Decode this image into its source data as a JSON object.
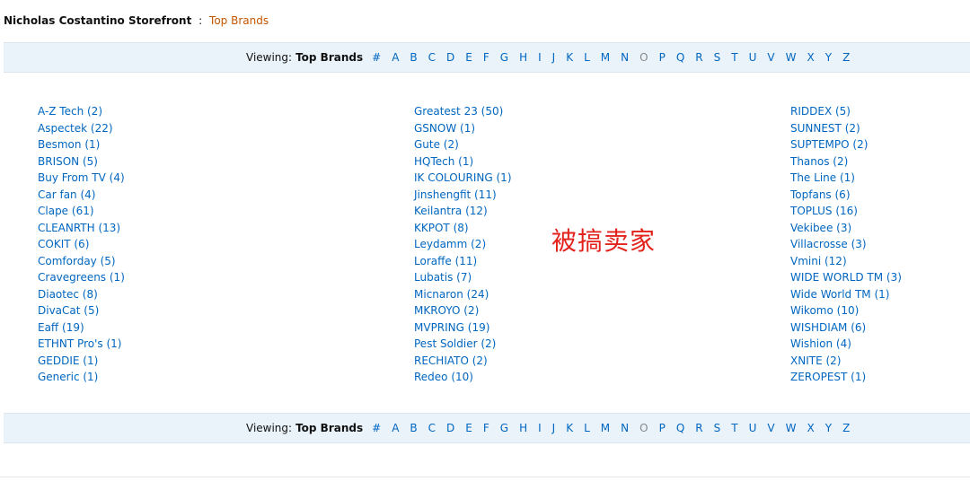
{
  "breadcrumb": {
    "store": "Nicholas Costantino Storefront",
    "separator": ":",
    "current": "Top Brands"
  },
  "nav": {
    "viewing_label": "Viewing:",
    "viewing_value": "Top Brands",
    "letters": [
      "#",
      "A",
      "B",
      "C",
      "D",
      "E",
      "F",
      "G",
      "H",
      "I",
      "J",
      "K",
      "L",
      "M",
      "N",
      "O",
      "P",
      "Q",
      "R",
      "S",
      "T",
      "U",
      "V",
      "W",
      "X",
      "Y",
      "Z"
    ],
    "disabled_letters": [
      "O"
    ]
  },
  "brands": {
    "col1": [
      "A-Z Tech (2)",
      "Aspectek (22)",
      "Besmon (1)",
      "BRISON (5)",
      "Buy From TV (4)",
      "Car fan (4)",
      "Clape (61)",
      "CLEANRTH (13)",
      "COKIT (6)",
      "Comforday (5)",
      "Cravegreens (1)",
      "Diaotec (8)",
      "DivaCat (5)",
      "Eaff (19)",
      "ETHNT Pro's (1)",
      "GEDDIE (1)",
      "Generic (1)"
    ],
    "col2": [
      "Greatest 23 (50)",
      "GSNOW (1)",
      "Gute (2)",
      "HQTech (1)",
      "IK COLOURING (1)",
      "Jinshengfit (11)",
      "Keilantra (12)",
      "KKPOT (8)",
      "Leydamm (2)",
      "Loraffe (11)",
      "Lubatis (7)",
      "Micnaron (24)",
      "MKROYO (2)",
      "MVPRING (19)",
      "Pest Soldier (2)",
      "RECHIATO (2)",
      "Redeo (10)"
    ],
    "col3": [
      "RIDDEX (5)",
      "SUNNEST (2)",
      "SUPTEMPO (2)",
      "Thanos (2)",
      "The Line (1)",
      "Topfans (6)",
      "TOPLUS (16)",
      "Vekibee (3)",
      "Villacrosse (3)",
      "Vmini (12)",
      "WIDE WORLD TM (3)",
      "Wide World TM (1)",
      "Wikomo (10)",
      "WISHDIAM (6)",
      "Wishion (4)",
      "XNITE (2)",
      "ZEROPEST (1)"
    ]
  },
  "overlay_text": "被搞卖家",
  "colors": {
    "link": "#0066c0",
    "crumb": "#c45500",
    "nav_bg": "#eaf3fa",
    "overlay": "#e3221c"
  }
}
